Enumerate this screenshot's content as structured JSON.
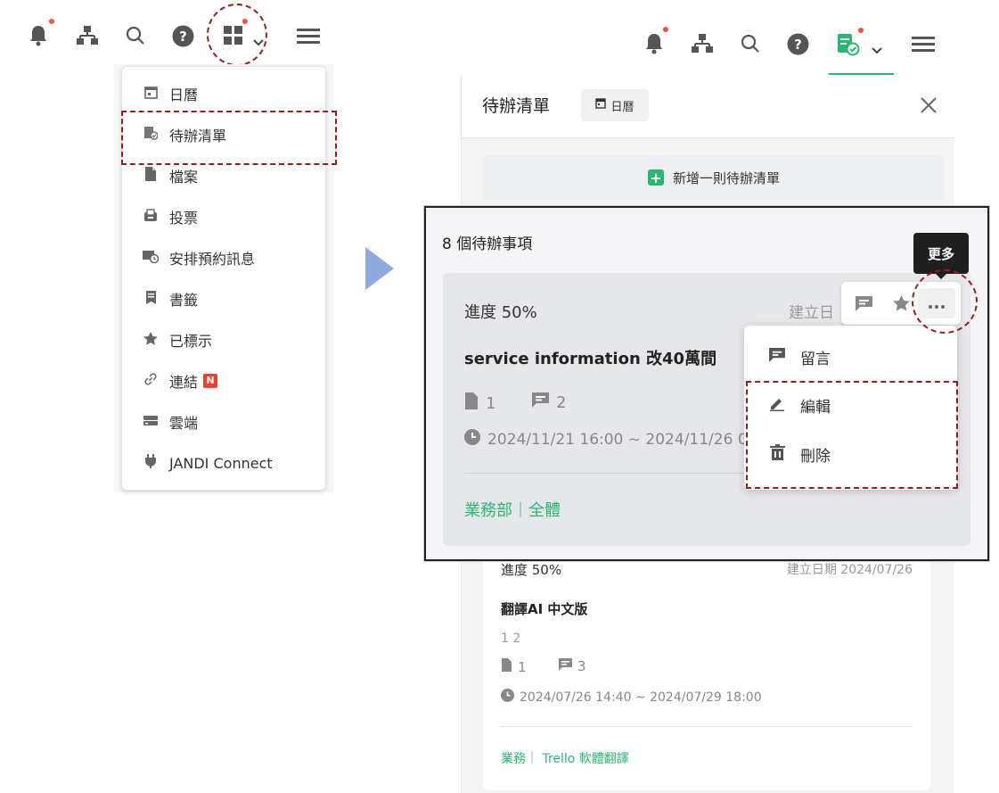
{
  "left_toolbar": {
    "icons": [
      "bell-icon",
      "org-chart-icon",
      "search-icon",
      "help-icon",
      "apps-icon",
      "chevron-down-icon",
      "hamburger-icon"
    ]
  },
  "left_menu": {
    "items": [
      {
        "label": "日曆",
        "icon": "calendar-icon"
      },
      {
        "label": "待辦清單",
        "icon": "todo-icon"
      },
      {
        "label": "檔案",
        "icon": "file-icon"
      },
      {
        "label": "投票",
        "icon": "vote-icon"
      },
      {
        "label": "安排預約訊息",
        "icon": "scheduled-message-icon"
      },
      {
        "label": "書籤",
        "icon": "bookmark-icon"
      },
      {
        "label": "已標示",
        "icon": "star-icon"
      },
      {
        "label": "連結",
        "icon": "link-icon",
        "badge": "N"
      },
      {
        "label": "雲端",
        "icon": "cloud-drive-icon"
      },
      {
        "label": "JANDI Connect",
        "icon": "plug-icon"
      }
    ]
  },
  "right_panel": {
    "title": "待辦清單",
    "calendar_button": "日曆",
    "add_button": "新增一則待辦清單",
    "count_label": "8 個待辦事項",
    "tooltip": "更多",
    "card1": {
      "progress": "進度 50%",
      "created": "建立日",
      "title": "service information 改40萬間",
      "files": "1",
      "comments": "2",
      "date_range": "2024/11/21 16:00 ~ 2024/11/26 0",
      "tags": "業務部｜全體"
    },
    "context_menu": [
      {
        "label": "留言",
        "icon": "comment-icon"
      },
      {
        "label": "編輯",
        "icon": "pencil-icon"
      },
      {
        "label": "刪除",
        "icon": "trash-icon"
      }
    ],
    "card2": {
      "progress": "進度 50%",
      "created": "建立日期 2024/07/26",
      "title": "翻譯AI 中文版",
      "subtext": "1 2",
      "files": "1",
      "comments": "3",
      "date_range": "2024/07/26 14:40 ~ 2024/07/29 18:00",
      "tags": "業務｜ Trello 軟體翻譯"
    }
  },
  "colors": {
    "accent": "#2bb673",
    "annotation": "#9b1c1c",
    "arrow": "#8faadc",
    "notify": "#f0533a"
  }
}
